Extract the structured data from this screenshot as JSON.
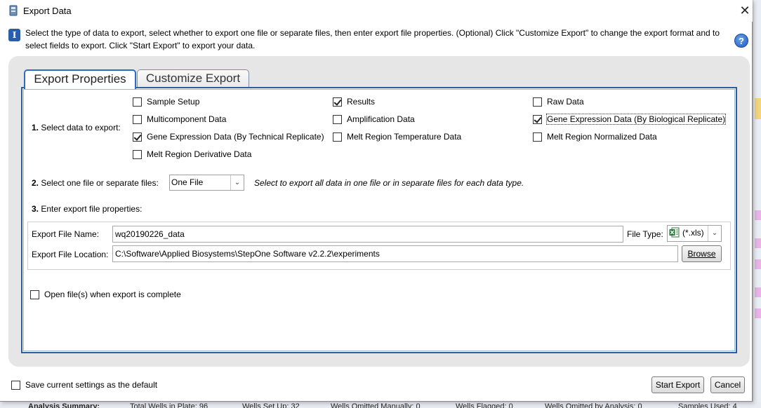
{
  "window": {
    "title": "Export Data",
    "close_glyph": "✕"
  },
  "instructions": {
    "text": "Select the type of data to export, select whether to export one file or separate files, then enter export file properties. (Optional) Click \"Customize Export\" to change the export format and to select fields to export. Click \"Start Export\" to export your data.",
    "info_glyph": "I",
    "help_glyph": "?"
  },
  "tabs": [
    {
      "label": "Export Properties",
      "active": true
    },
    {
      "label": "Customize Export",
      "active": false
    }
  ],
  "step1": {
    "number": "1.",
    "label": "Select data to export:",
    "options": [
      {
        "label": "Sample Setup",
        "checked": false
      },
      {
        "label": "Results",
        "checked": true
      },
      {
        "label": "Raw Data",
        "checked": false
      },
      {
        "label": "Multicomponent Data",
        "checked": false
      },
      {
        "label": "Amplification Data",
        "checked": false
      },
      {
        "label": "Gene Expression Data (By Biological Replicate)",
        "checked": true
      },
      {
        "label": "Gene Expression Data (By Technical Replicate)",
        "checked": true
      },
      {
        "label": "Melt Region Temperature Data",
        "checked": false
      },
      {
        "label": "Melt Region Normalized Data",
        "checked": false
      },
      {
        "label": "Melt Region Derivative Data",
        "checked": false
      }
    ]
  },
  "step2": {
    "number": "2.",
    "label": "Select one file or separate files:",
    "selected": "One File",
    "hint": "Select to export all data in one file or in separate files for each data type."
  },
  "step3": {
    "number": "3.",
    "label": "Enter export file properties:",
    "file_name_label": "Export File Name:",
    "file_name_value": "wq20190226_data",
    "file_type_label": "File Type:",
    "file_type_value": "(*.xls)",
    "file_location_label": "Export File Location:",
    "file_location_value": "C:\\Software\\Applied Biosystems\\StepOne Software v2.2.2\\experiments",
    "browse_label": "Browse"
  },
  "open_when_complete": {
    "label": "Open file(s) when export is complete",
    "checked": false
  },
  "save_default": {
    "label": "Save current settings as the default",
    "checked": false
  },
  "footer": {
    "start_export_label": "Start Export",
    "cancel_label": "Cancel"
  },
  "background_status": {
    "items": [
      "Analysis Summary:",
      "Total Wells in Plate: 96",
      "Wells Set Up: 32",
      "Wells Omitted Manually: 0",
      "Wells Flagged: 0",
      "Wells Omitted by Analysis: 0",
      "Samples Used: 4"
    ]
  },
  "colors": {
    "accent_blue": "#2d5ea3",
    "panel_gray": "#e6e6e6"
  }
}
